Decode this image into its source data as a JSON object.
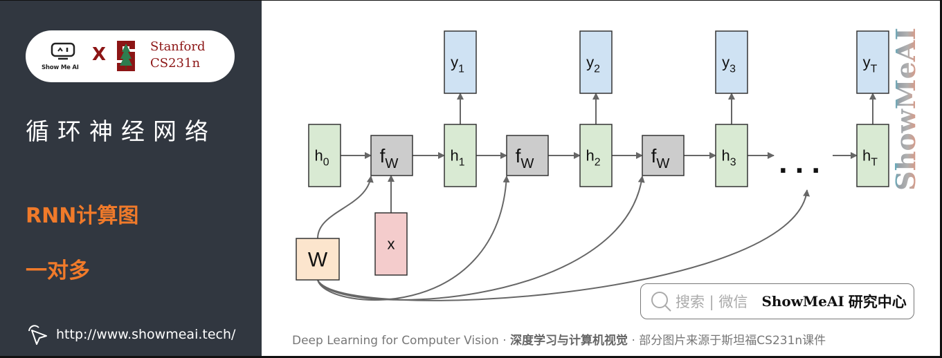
{
  "sidebar": {
    "logo": {
      "showmeai_text": "Show Me AI",
      "cross": "X",
      "partner_line1": "Stanford",
      "partner_line2": "CS231n"
    },
    "title": "循环神经网络",
    "subtitle1": "RNN计算图",
    "subtitle2": "一对多",
    "url": "http://www.showmeai.tech/"
  },
  "diagram": {
    "input_node": "x",
    "weight_node": "W",
    "initial_hidden": {
      "base": "h",
      "sub": "0"
    },
    "function_label": {
      "base": "f",
      "sub": "W"
    },
    "hidden_states": [
      {
        "base": "h",
        "sub": "1"
      },
      {
        "base": "h",
        "sub": "2"
      },
      {
        "base": "h",
        "sub": "3"
      },
      {
        "base": "h",
        "sub": "T"
      }
    ],
    "outputs": [
      {
        "base": "y",
        "sub": "1"
      },
      {
        "base": "y",
        "sub": "2"
      },
      {
        "base": "y",
        "sub": "3"
      },
      {
        "base": "y",
        "sub": "T"
      }
    ],
    "ellipsis": "...",
    "colors": {
      "hidden_fill": "#d9ead3",
      "output_fill": "#cfe2f3",
      "function_fill": "#cccccc",
      "input_fill": "#f4cccc",
      "weight_fill": "#fce5cd",
      "arrow": "#666666"
    }
  },
  "watermark": "ShowMeAI",
  "search_box": {
    "label": "搜索 | 微信",
    "brand": "ShowMeAI",
    "brand_suffix": "研究中心"
  },
  "footer": {
    "part1": "Deep Learning for Computer Vision",
    "sep": " · ",
    "part2": "深度学习与计算机视觉",
    "part3": "部分图片来源于斯坦福CS231n课件"
  }
}
